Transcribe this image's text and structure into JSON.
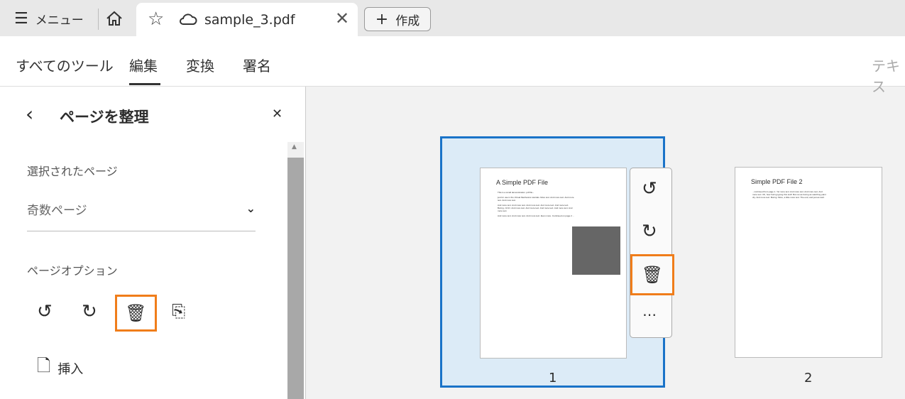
{
  "tabbar": {
    "menu_label": "メニュー",
    "tab_title": "sample_3.pdf",
    "create_label": "作成"
  },
  "toolbar": {
    "tabs": [
      "すべてのツール",
      "編集",
      "変換",
      "署名"
    ],
    "search_placeholder": "テキス"
  },
  "panel": {
    "title": "ページを整理",
    "selected_pages_label": "選択されたページ",
    "selected_pages_value": "奇数ページ",
    "page_options_label": "ページオプション",
    "insert_label": "挿入"
  },
  "pages": [
    {
      "number": "1",
      "title": "A Simple PDF File",
      "lines": [
        "This is a small demonstration .pdf file -",
        "just for use in the Virtual Mechanics tutorials. More text. And more text. And more text. And more text.",
        "And more text. And more text. And more text. And more text. And more text. Boring, zzzzz. And more text. And more text. And more text. And more text. And more text.",
        "And more text. And more text. And more text. Even more. Continued on page 2 ..."
      ]
    },
    {
      "number": "2",
      "title": "Simple PDF File 2",
      "lines": [
        "...continued from page 1. Yet more text. And more text. And more text. And more text. Oh, how boring typing this stuff. But not as boring as watching paint dry. And more text. Boring. More, a little more text. The end, and just as well."
      ]
    }
  ],
  "accent": "#1a73c8",
  "highlight": "#f07d1a"
}
